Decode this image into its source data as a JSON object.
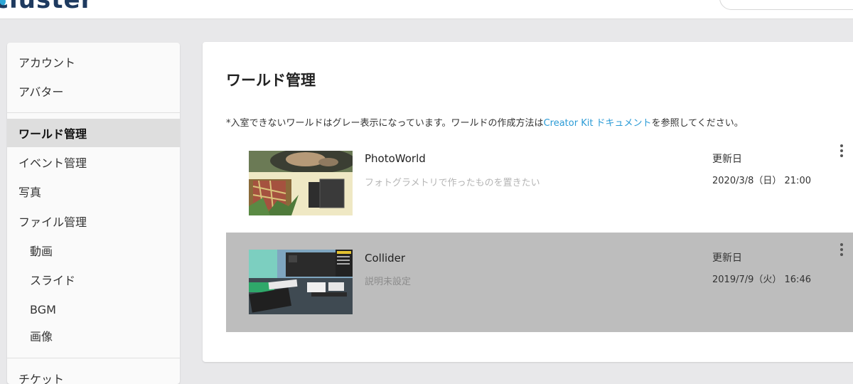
{
  "app": {
    "logo_text": "cluster"
  },
  "sidebar": {
    "items": [
      {
        "label": "アカウント"
      },
      {
        "label": "アバター"
      },
      {
        "label": "ワールド管理"
      },
      {
        "label": "イベント管理"
      },
      {
        "label": "写真"
      },
      {
        "label": "ファイル管理"
      },
      {
        "label": "動画"
      },
      {
        "label": "スライド"
      },
      {
        "label": "BGM"
      },
      {
        "label": "画像"
      },
      {
        "label": "チケット"
      }
    ],
    "active_index": 2
  },
  "main": {
    "title": "ワールド管理",
    "notice_prefix": "*入室できないワールドはグレー表示になっています。ワールドの作成方法は",
    "notice_link": "Creator Kit ドキュメント",
    "notice_suffix": "を参照してください。",
    "link_color": "#2b9bd6",
    "updated_label": "更新日",
    "worlds": [
      {
        "name": "PhotoWorld",
        "description": "フォトグラメトリで作ったものを置きたい",
        "updated": "2020/3/8（日） 21:00",
        "enabled": true
      },
      {
        "name": "Collider",
        "description": "説明未設定",
        "updated": "2019/7/9（火） 16:46",
        "enabled": false
      }
    ]
  },
  "icons": {
    "row_menu": "more-vertical-icon"
  },
  "colors": {
    "disabled_row": "#bdbdbd",
    "active_sidebar": "#dedede",
    "page_bg": "#e8e8ea"
  }
}
